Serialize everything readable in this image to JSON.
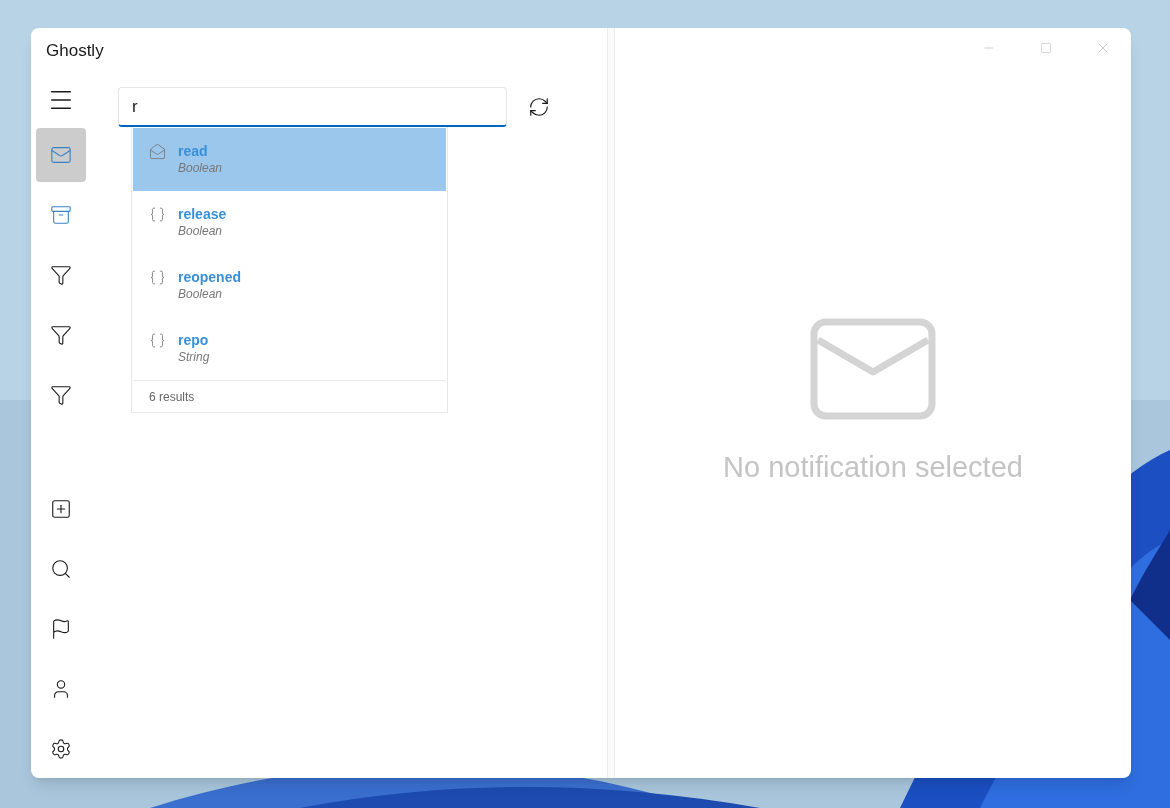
{
  "window": {
    "title": "Ghostly"
  },
  "nav": {
    "top": [
      {
        "kind": "mail",
        "selected": true
      },
      {
        "kind": "archive",
        "selected": false
      },
      {
        "kind": "filter",
        "selected": false
      },
      {
        "kind": "filter",
        "selected": false
      },
      {
        "kind": "filter",
        "selected": false
      }
    ],
    "bottom": [
      {
        "kind": "new-note",
        "selected": false
      },
      {
        "kind": "search",
        "selected": false
      },
      {
        "kind": "flag",
        "selected": false
      },
      {
        "kind": "person",
        "selected": false
      },
      {
        "kind": "settings",
        "selected": false
      }
    ]
  },
  "search": {
    "value": "r"
  },
  "suggestions": {
    "items": [
      {
        "kind": "envelope",
        "name": "read",
        "type": "Boolean",
        "selected": true
      },
      {
        "kind": "braces",
        "name": "release",
        "type": "Boolean",
        "selected": false
      },
      {
        "kind": "braces",
        "name": "reopened",
        "type": "Boolean",
        "selected": false
      },
      {
        "kind": "braces",
        "name": "repo",
        "type": "String",
        "selected": false
      }
    ],
    "footer": "6 results"
  },
  "detail": {
    "empty_text": "No notification selected"
  }
}
